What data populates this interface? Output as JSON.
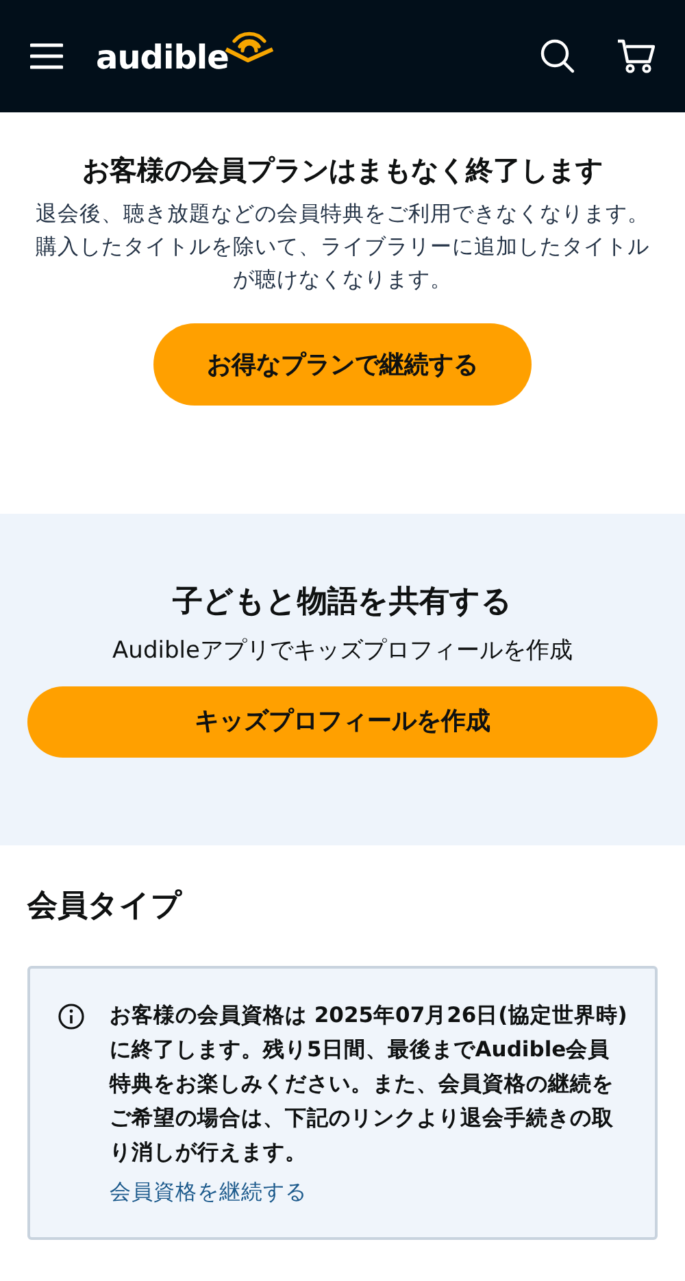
{
  "header": {
    "logo": "audible"
  },
  "ending_notice": {
    "title": "お客様の会員プランはまもなく終了します",
    "text": "退会後、聴き放題などの会員特典をご利用できなくなります。購入したタイトルを除いて、ライブラリーに追加したタイトルが聴けなくなります。",
    "button": "お得なプランで継続する"
  },
  "kids": {
    "title": "子どもと物語を共有する",
    "subtitle": "Audibleアプリでキッズプロフィールを作成",
    "button": "キッズプロフィールを作成"
  },
  "membership": {
    "heading": "会員タイプ",
    "alert": {
      "text": "お客様の会員資格は 2025年07月26日(協定世界時)に終了します。残り5日間、最後までAudible会員特典をお楽しみください。また、会員資格の継続をご希望の場合は、下記のリンクより退会手続きの取り消しが行えます。",
      "link": "会員資格を継続する"
    }
  }
}
